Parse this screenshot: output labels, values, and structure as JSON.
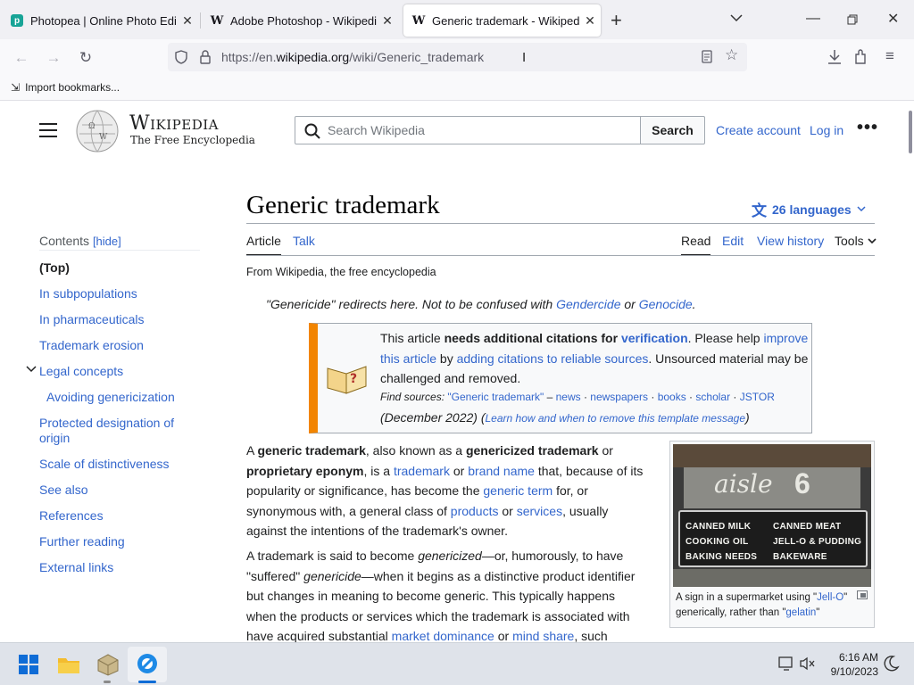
{
  "browser": {
    "tabs": [
      {
        "title": "Photopea | Online Photo Editor",
        "favicon": "photopea-icon"
      },
      {
        "title": "Adobe Photoshop - Wikipedia",
        "favicon": "W"
      },
      {
        "title": "Generic trademark - Wikipedia",
        "favicon": "W",
        "active": true
      }
    ],
    "url_prefix": "https://en.",
    "url_domain": "wikipedia.org",
    "url_path": "/wiki/Generic_trademark",
    "bookmark": "Import bookmarks..."
  },
  "wiki": {
    "wordmark": "Wikipedia",
    "tagline": "The Free Encyclopedia",
    "search_placeholder": "Search Wikipedia",
    "search_button": "Search",
    "create_account": "Create account",
    "log_in": "Log in",
    "title": "Generic trademark",
    "languages": "26 languages",
    "tab_article": "Article",
    "tab_talk": "Talk",
    "tab_read": "Read",
    "tab_edit": "Edit",
    "tab_history": "View history",
    "tab_tools": "Tools",
    "from": "From Wikipedia, the free encyclopedia"
  },
  "toc": {
    "heading": "Contents",
    "hide": "[hide]",
    "items": [
      {
        "label": "(Top)"
      },
      {
        "label": "In subpopulations"
      },
      {
        "label": "In pharmaceuticals"
      },
      {
        "label": "Trademark erosion"
      },
      {
        "label": "Legal concepts"
      },
      {
        "label": "Avoiding genericization"
      },
      {
        "label": "Protected designation of origin"
      },
      {
        "label": "Scale of distinctiveness"
      },
      {
        "label": "See also"
      },
      {
        "label": "References"
      },
      {
        "label": "Further reading"
      },
      {
        "label": "External links"
      }
    ]
  },
  "hatnote": {
    "t1": "\"Genericide\" redirects here. Not to be confused with ",
    "l1": "Gendercide",
    "t2": " or ",
    "l2": "Genocide",
    "t3": "."
  },
  "ambox": {
    "t1": "This article ",
    "b1": "needs additional citations for ",
    "l1": "verification",
    "t2": ". Please help ",
    "l2": "improve this article",
    "t3": " by ",
    "l3": "adding citations to reliable sources",
    "t4": ". Unsourced material may be challenged and removed.",
    "find": "Find sources:",
    "q": "\"Generic trademark\"",
    "dash": " – ",
    "s1": "news",
    "s2": "newspapers",
    "s3": "books",
    "s4": "scholar",
    "s5": "JSTOR",
    "dot": " · ",
    "date": "(December 2022)",
    "learn": "Learn how and when to remove this template message",
    "open_paren": " (",
    "close_paren": ")"
  },
  "para1": {
    "a": "A ",
    "b1": "generic trademark",
    "c": ", also known as a ",
    "b2": "genericized trademark",
    "d": " or ",
    "b3": "proprietary eponym",
    "e": ", is a ",
    "l1": "trademark",
    "f": " or ",
    "l2": "brand name",
    "g": " that, because of its popularity or significance, has become the ",
    "l3": "generic term",
    "h": " for, or synonymous with, a general class of ",
    "l4": "products",
    "i": " or ",
    "l5": "services",
    "j": ", usually against the intentions of the trademark's owner."
  },
  "para2": {
    "a": "A trademark is said to become ",
    "i1": "genericized",
    "b": "—or, humorously, to have \"suffered\" ",
    "i2": "genericide",
    "c": "—when it begins as a distinctive product identifier but changes in meaning to become generic. This typically happens when the products or services which the trademark is associated with have acquired substantial ",
    "l1": "market dominance",
    "d": " or ",
    "l2": "mind share",
    "e": ", such"
  },
  "figure": {
    "sign_top": "aisle",
    "sign_num": "6",
    "r1a": "CANNED MILK",
    "r1b": "CANNED MEAT",
    "r2a": "COOKING OIL",
    "r2b": "JELL-O & PUDDING",
    "r3a": "BAKING NEEDS",
    "r3b": "BAKEWARE",
    "cap1": "A sign in a supermarket using \"",
    "capl1": "Jell-O",
    "cap2": "\" generically, rather than \"",
    "capl2": "gelatin",
    "cap3": "\""
  },
  "taskbar": {
    "time": "6:16 AM",
    "date": "9/10/2023"
  }
}
